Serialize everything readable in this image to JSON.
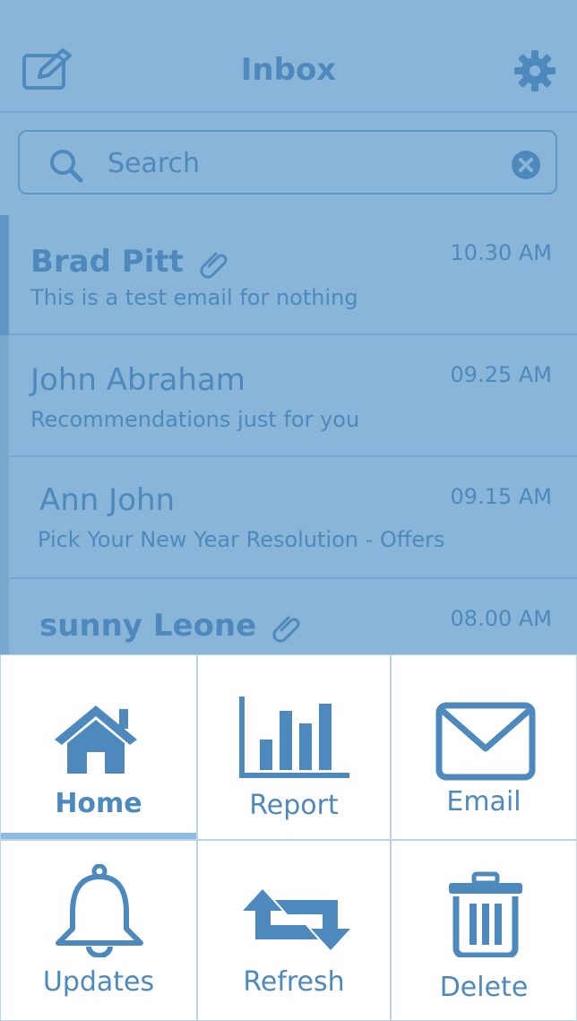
{
  "header": {
    "title": "Inbox",
    "compose_icon": "compose-icon",
    "settings_icon": "gear-icon"
  },
  "search": {
    "placeholder": "Search",
    "value": ""
  },
  "emails": [
    {
      "sender": "Brad Pitt",
      "preview": "This is a test email for nothing",
      "time": "10.30 AM",
      "attachment": true,
      "unread": true
    },
    {
      "sender": "John Abraham",
      "preview": "Recommendations just for you",
      "time": "09.25 AM",
      "attachment": false,
      "unread": false
    },
    {
      "sender": "Ann John",
      "preview": "Pick Your New Year Resolution - Offers",
      "time": "09.15 AM",
      "attachment": false,
      "unread": false
    },
    {
      "sender": "sunny Leone",
      "preview": "",
      "time": "08.00 AM",
      "attachment": true,
      "unread": true
    }
  ],
  "menu": {
    "items": [
      {
        "label": "Home",
        "icon": "home-icon",
        "active": true
      },
      {
        "label": "Report",
        "icon": "bar-chart-icon",
        "active": false
      },
      {
        "label": "Email",
        "icon": "envelope-icon",
        "active": false
      },
      {
        "label": "Updates",
        "icon": "bell-icon",
        "active": false
      },
      {
        "label": "Refresh",
        "icon": "refresh-icon",
        "active": false
      },
      {
        "label": "Delete",
        "icon": "trash-icon",
        "active": false
      }
    ]
  },
  "colors": {
    "overlay": "#89b6d8",
    "accent": "#4e89bd",
    "divider": "#b9d3e8",
    "active_bar": "#8cbce3"
  }
}
